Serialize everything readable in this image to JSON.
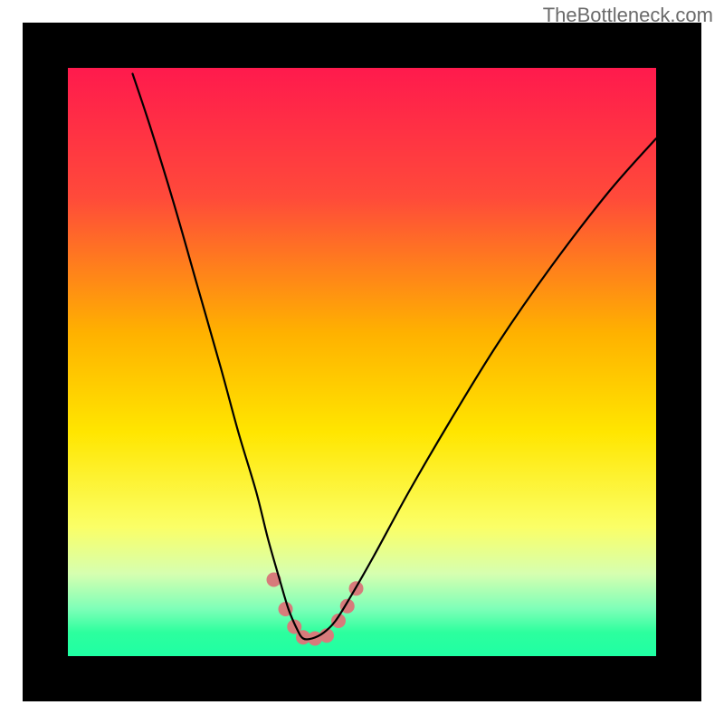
{
  "watermark": "TheBottleneck.com",
  "chart_data": {
    "type": "line",
    "title": "",
    "xlabel": "",
    "ylabel": "",
    "xlim": [
      0,
      100
    ],
    "ylim": [
      0,
      100
    ],
    "gradient_stops": [
      {
        "offset": 0.0,
        "color": "#ff1a4d"
      },
      {
        "offset": 0.22,
        "color": "#ff4a3a"
      },
      {
        "offset": 0.45,
        "color": "#ffb100"
      },
      {
        "offset": 0.62,
        "color": "#ffe600"
      },
      {
        "offset": 0.78,
        "color": "#fbff66"
      },
      {
        "offset": 0.86,
        "color": "#d6ffb0"
      },
      {
        "offset": 0.92,
        "color": "#7dffb8"
      },
      {
        "offset": 0.96,
        "color": "#2cff9e"
      },
      {
        "offset": 1.0,
        "color": "#1fffa3"
      }
    ],
    "series": [
      {
        "name": "bottleneck-curve",
        "color": "#000000",
        "x": [
          11,
          14,
          18,
          22,
          26,
          29,
          32,
          34,
          36,
          37.5,
          39,
          40,
          41.5,
          43.5,
          45.5,
          48,
          52,
          58,
          65,
          73,
          82,
          92,
          100
        ],
        "y": [
          99,
          90,
          77,
          63,
          49,
          38,
          28,
          20,
          13,
          8,
          4.5,
          3,
          3,
          4,
          6,
          10,
          17,
          28,
          40,
          53,
          66,
          79,
          88
        ]
      }
    ],
    "markers": {
      "name": "highlight-points",
      "color": "#d77b7b",
      "radius": 8,
      "points": [
        {
          "x": 35.0,
          "y": 13.0
        },
        {
          "x": 37.0,
          "y": 8.0
        },
        {
          "x": 38.5,
          "y": 5.0
        },
        {
          "x": 40.0,
          "y": 3.2
        },
        {
          "x": 42.0,
          "y": 3.0
        },
        {
          "x": 44.0,
          "y": 3.5
        },
        {
          "x": 46.0,
          "y": 6.0
        },
        {
          "x": 47.5,
          "y": 8.5
        },
        {
          "x": 49.0,
          "y": 11.5
        }
      ]
    },
    "frame": {
      "outer_margin": 25,
      "stroke": "#000000",
      "stroke_width": 50
    }
  }
}
